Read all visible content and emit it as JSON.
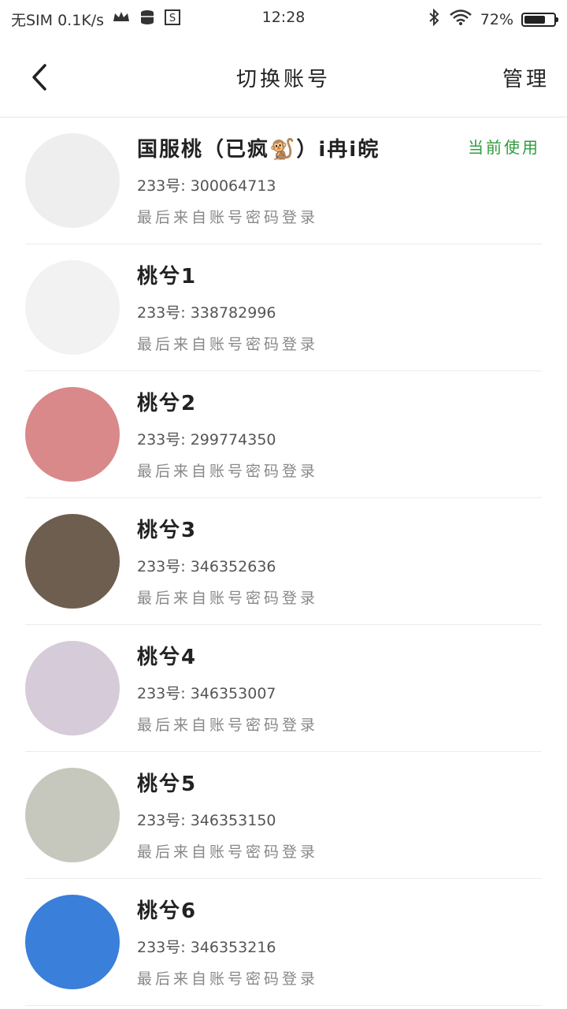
{
  "status_bar": {
    "carrier": "无SIM 0.1K/s",
    "time": "12:28",
    "battery": "72%",
    "battery_level": 0.72
  },
  "header": {
    "title": "切换账号",
    "manage_label": "管理"
  },
  "accounts": [
    {
      "name": "国服桃（已疯🐒）i冉i皖",
      "id": "233号: 300064713",
      "login": "最后来自账号密码登录",
      "current": "当前使用",
      "avatar_bg": "#eeeeee"
    },
    {
      "name": "桃兮1",
      "id": "233号: 338782996",
      "login": "最后来自账号密码登录",
      "avatar_bg": "#f2f2f2"
    },
    {
      "name": "桃兮2",
      "id": "233号: 299774350",
      "login": "最后来自账号密码登录",
      "avatar_bg": "#d98989"
    },
    {
      "name": "桃兮3",
      "id": "233号: 346352636",
      "login": "最后来自账号密码登录",
      "avatar_bg": "#6e5e4f"
    },
    {
      "name": "桃兮4",
      "id": "233号: 346353007",
      "login": "最后来自账号密码登录",
      "avatar_bg": "#d6cbd8"
    },
    {
      "name": "桃兮5",
      "id": "233号: 346353150",
      "login": "最后来自账号密码登录",
      "avatar_bg": "#c7c8bd"
    },
    {
      "name": "桃兮6",
      "id": "233号: 346353216",
      "login": "最后来自账号密码登录",
      "avatar_bg": "#3a7fd9"
    }
  ]
}
